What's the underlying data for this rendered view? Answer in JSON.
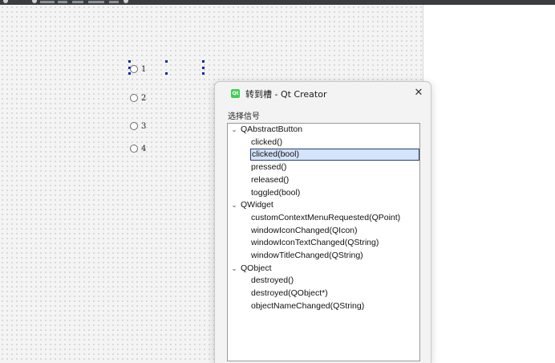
{
  "form": {
    "radio_buttons": [
      {
        "label": "1"
      },
      {
        "label": "2"
      },
      {
        "label": "3"
      },
      {
        "label": "4"
      }
    ]
  },
  "dialog": {
    "title": "转到槽 - Qt Creator",
    "app_icon": "qt-icon",
    "app_icon_text": "Qt",
    "close_label": "✕",
    "group_label": "选择信号",
    "tree": [
      {
        "class": "QAbstractButton",
        "expanded": true,
        "signals": [
          "clicked()",
          "clicked(bool)",
          "pressed()",
          "released()",
          "toggled(bool)"
        ]
      },
      {
        "class": "QWidget",
        "expanded": true,
        "signals": [
          "customContextMenuRequested(QPoint)",
          "windowIconChanged(QIcon)",
          "windowIconTextChanged(QString)",
          "windowTitleChanged(QString)"
        ]
      },
      {
        "class": "QObject",
        "expanded": true,
        "signals": [
          "destroyed()",
          "destroyed(QObject*)",
          "objectNameChanged(QString)"
        ]
      }
    ],
    "selected_signal": "clicked(bool)"
  },
  "colors": {
    "selection_bg": "#d4e4fb",
    "selection_border": "#2a3e6b",
    "handle": "#0b2aa7",
    "qt_green": "#41cd52"
  }
}
